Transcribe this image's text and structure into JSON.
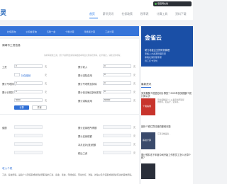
{
  "header": {
    "logo": "灵",
    "user_badge": "佰佰网在线",
    "nav": [
      {
        "label": "首页",
        "active": true
      },
      {
        "label": "薪讯资讯",
        "active": false
      },
      {
        "label": "社保政策",
        "active": false
      },
      {
        "label": "税率表",
        "active": false
      },
      {
        "label": "计算工具",
        "active": false
      },
      {
        "label": "资料下载",
        "active": false
      }
    ]
  },
  "subnav": [
    "社保查询",
    "公积金查询",
    "五险一金",
    "个税计算",
    "年终奖计算",
    "工资计算"
  ],
  "form": {
    "title": "请填写工资信息",
    "hint": "请填写税前工资；累计专项附加扣除请根据本年度实际情况填写，如不确定，请按实际填写。",
    "rows": [
      {
        "left_label": "工资",
        "left_value": "0",
        "left_unit": "元",
        "right_label": "累计收入",
        "right_value": "0",
        "right_unit": "元"
      },
      {
        "left_label": "",
        "left_value": "0",
        "left_unit": "元",
        "right_label": "累计减除费用",
        "right_value": "0",
        "right_unit": "元"
      },
      {
        "left_label": "累计专项扣除",
        "left_value": "0",
        "left_unit": "元",
        "right_label": "累计专项附加扣除",
        "right_value": "0",
        "right_unit": "元"
      },
      {
        "left_label": "累计已预扣",
        "left_value": "0",
        "left_unit": "元",
        "right_label": "累计依法确定其他扣除",
        "right_value": "0",
        "right_unit": "元"
      },
      {
        "left_label": "",
        "left_value": "5000",
        "left_unit": "元",
        "right_label": "累计减除费用",
        "right_value": "60000",
        "right_unit": "元"
      }
    ],
    "left_links": [
      "",
      "社保缴纳",
      "",
      "",
      ""
    ],
    "calc_label": "计算",
    "reset_label": "重置"
  },
  "results": {
    "rows": [
      {
        "left_label": "缴额",
        "right_label": "累计应纳税所得额",
        "right_unit": "元"
      },
      {
        "left_label": "",
        "right_label": "累计应纳税额",
        "right_unit": "元"
      },
      {
        "left_label": "",
        "right_label": "本月应补(退)税额",
        "right_unit": "元"
      },
      {
        "left_label": "",
        "right_label": "税后工资",
        "right_unit": "元"
      }
    ]
  },
  "section": {
    "heading": "收入个税",
    "description": "工资、薪金所得，是指个人因任职或者受雇而取得的工资、薪金、奖金、年终加薪、劳动分红、津贴、补贴以及与任职或者受雇有关的其他所得。"
  },
  "sidebar": {
    "ad": {
      "logo": "金雀云",
      "lines": [
        "助力老板企业的财务管理",
        "老板人力资源管理专家",
        "薪税社保管理专家",
        "员工打卡无忧"
      ]
    },
    "tab_label": "最新资讯",
    "articles": [
      {
        "title": "劳务报酬个税是如何计算的？2022年劳务报酬个税计算公式",
        "meta": "查看详情"
      },
      {
        "title": "",
        "meta": "劳务报酬是个人从事劳务所取得的所得，如设计、装潢等。"
      },
      {
        "title": "剖析个税汇算清缴的疑难问题",
        "meta": "查看详情"
      },
      {
        "title": "",
        "meta": "汇算清缴是指..."
      },
      {
        "title": "累计预扣法下年度中间开始工作的员工怎么计算个税？",
        "meta": ""
      }
    ],
    "thumb_labels": [
      "个税指南",
      "薪资计算"
    ]
  },
  "colors": {
    "accent": "#3574d9",
    "ad_bg": "#1a4fa6",
    "page_bg": "#f2f3f5"
  }
}
